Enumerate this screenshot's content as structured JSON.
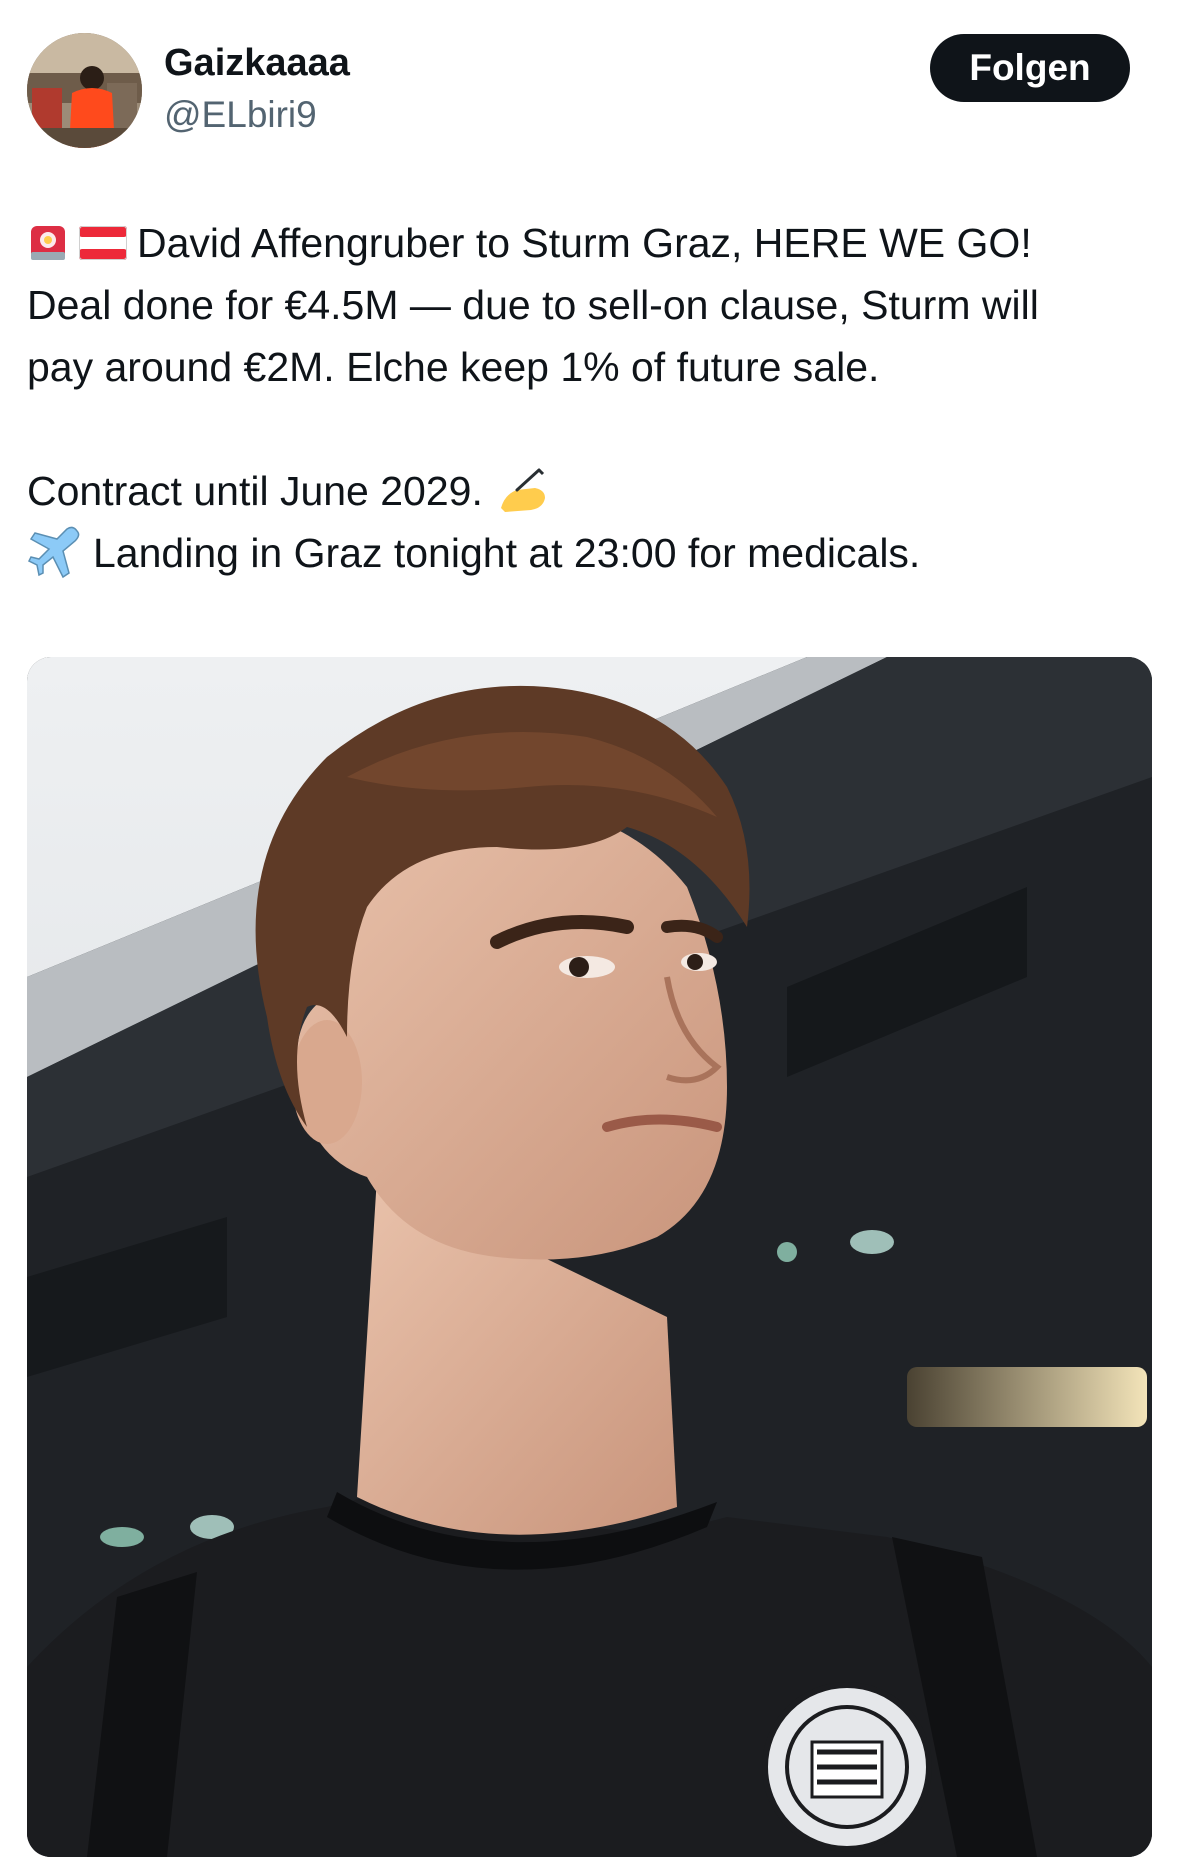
{
  "user": {
    "name": "Gaizkaaaa",
    "handle": "@ELbiri9",
    "avatar_icon": "user-avatar"
  },
  "follow": {
    "label": "Folgen"
  },
  "tweet": {
    "line1": "David Affengruber to Sturm Graz, HERE WE GO!",
    "line2": "Deal done for €4.5M — due to sell-on clause, Sturm will",
    "line3": "pay around €2M. Elche keep 1% of future sale.",
    "line4": "Contract until June 2029.",
    "line5": "Landing in Graz tonight at 23:00 for medicals.",
    "emojis": [
      "siren-icon",
      "austria-flag-icon",
      "writing-hand-icon",
      "airplane-icon"
    ]
  },
  "media": {
    "photo_icon": "player-photo"
  },
  "colors": {
    "text": "#0f1419",
    "secondary": "#536471",
    "button_bg": "#0f1419",
    "button_text": "#ffffff"
  }
}
